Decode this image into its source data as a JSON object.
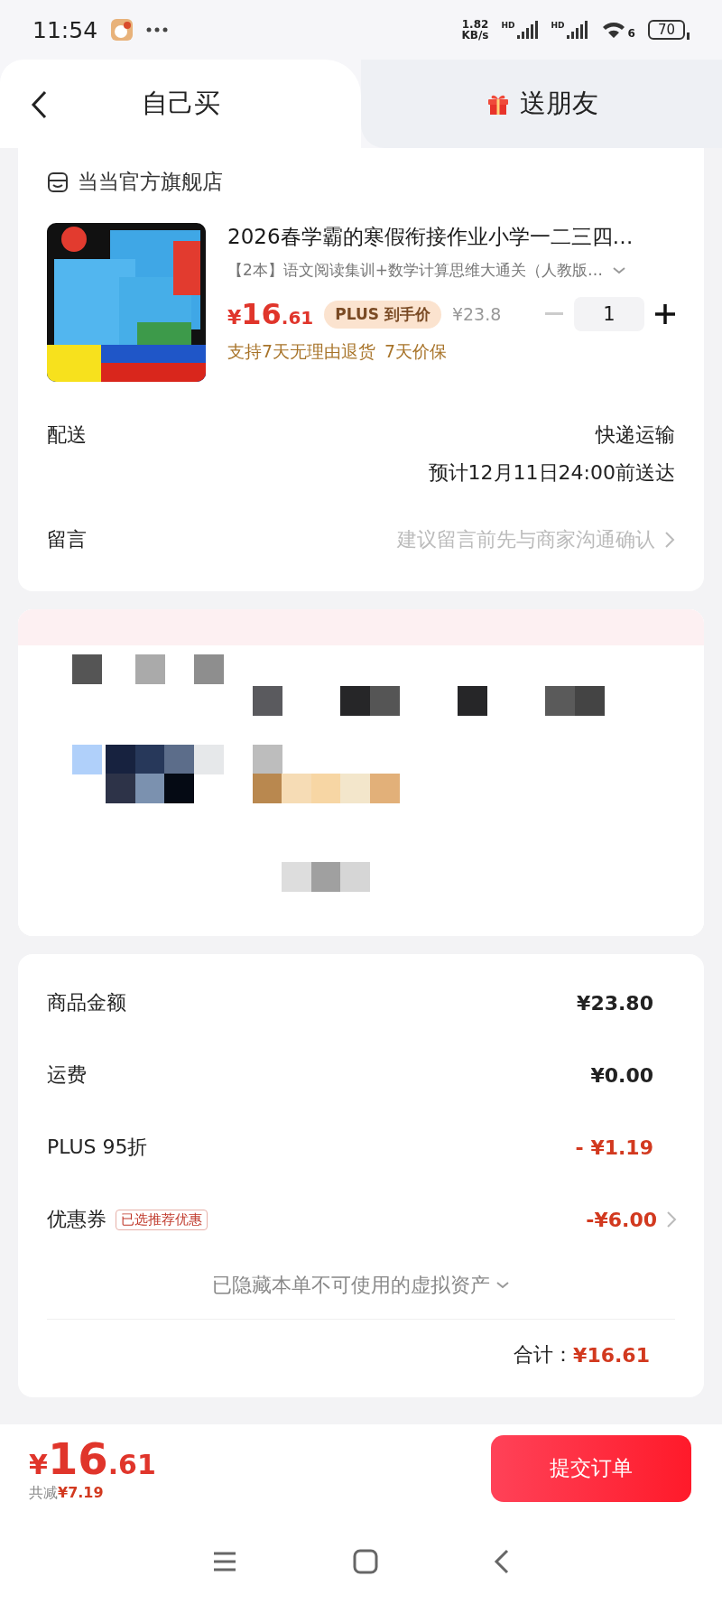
{
  "status_bar": {
    "time": "11:54",
    "speed_value": "1.82",
    "speed_unit": "KB/s",
    "sim_labels": [
      "HD",
      "HD"
    ],
    "wifi_label": "6",
    "battery": "70"
  },
  "tabs": [
    {
      "label": "自己买",
      "selected": true
    },
    {
      "label": "送朋友",
      "selected": false
    }
  ],
  "store": {
    "name": "当当官方旗舰店"
  },
  "product": {
    "title": "2026春学霸的寒假衔接作业小学一二三四…",
    "spec": "【2本】语文阅读集训+数学计算思维大通关（人教版…",
    "price_symbol": "¥",
    "price_int": "16",
    "price_dec": ".61",
    "plus_badge": "PLUS 到手价",
    "original_price": "¥23.8",
    "quantity": "1",
    "services": [
      "支持7天无理由退货",
      "7天价保"
    ]
  },
  "delivery": {
    "label": "配送",
    "method": "快递运输",
    "eta": "预计12月11日24:00前送达"
  },
  "message": {
    "label": "留言",
    "placeholder": "建议留言前先与商家沟通确认"
  },
  "summary": {
    "rows": [
      {
        "label": "商品金额",
        "value": "¥23.80",
        "kind": "plain",
        "link": false
      },
      {
        "label": "运费",
        "value": "¥0.00",
        "kind": "plain",
        "link": false
      },
      {
        "label": "PLUS 95折",
        "value": "- ¥1.19",
        "kind": "discount",
        "link": false
      },
      {
        "label": "优惠券",
        "tag": "已选推荐优惠",
        "value": "-¥6.00",
        "kind": "discount",
        "link": true
      }
    ],
    "hidden_assets": "已隐藏本单不可使用的虚拟资产",
    "total_label": "合计：",
    "total_value": "¥16.61"
  },
  "bottom_bar": {
    "price_symbol": "¥",
    "price_int": "16",
    "price_dec": ".61",
    "saved_label": "共减",
    "saved_value": "¥7.19",
    "submit": "提交订单"
  }
}
